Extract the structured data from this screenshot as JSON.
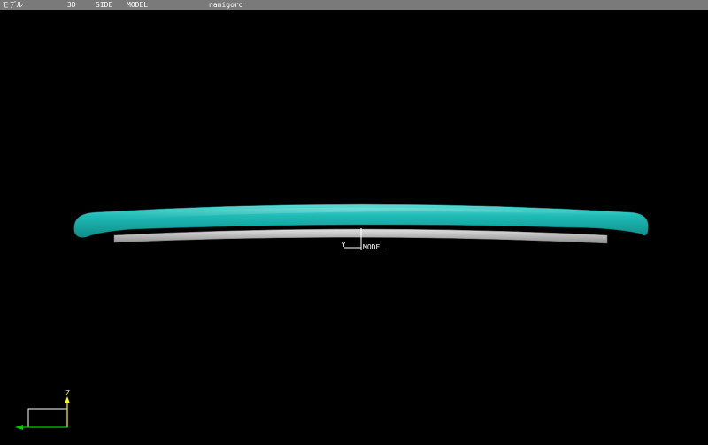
{
  "titlebar": {
    "mode": "モデル",
    "dimension": "3D",
    "view": "SIDE",
    "space": "MODEL",
    "filename": "namigoro"
  },
  "scene": {
    "object": "surfboard-side-profile",
    "deck_color": "#1db4b0",
    "rail_color": "#bfbfbf",
    "background_color": "#000000"
  },
  "origin_marker": {
    "axis_label": "Y",
    "space_label": "MODEL"
  },
  "axis_triad": {
    "vertical_label": "Z",
    "vertical_color": "#ffff00",
    "horizontal_color": "#00cc00",
    "box_color": "#ffffff"
  }
}
